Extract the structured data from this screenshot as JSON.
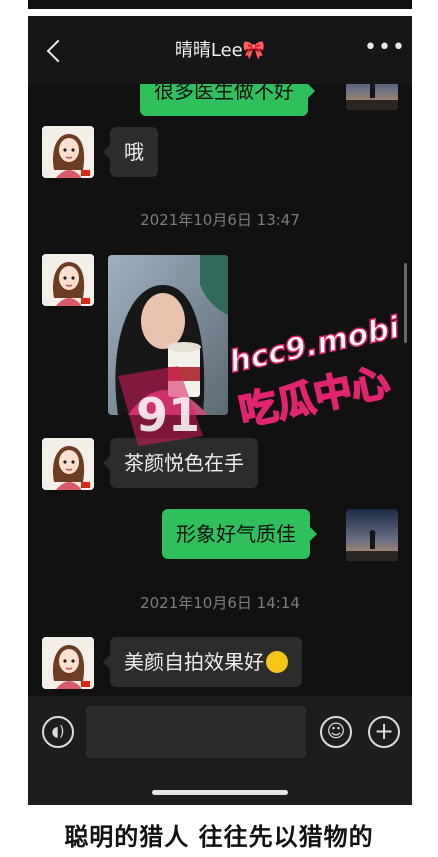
{
  "header": {
    "title": "晴晴Lee🎀",
    "more_label": "•••"
  },
  "messages": [
    {
      "side": "right",
      "text": "很多医生做不好"
    },
    {
      "side": "left",
      "text": "哦"
    },
    {
      "timestamp": "2021年10月6日 13:47"
    },
    {
      "side": "left",
      "type": "image"
    },
    {
      "side": "left",
      "text": "茶颜悦色在手"
    },
    {
      "side": "right",
      "text": "形象好气质佳"
    },
    {
      "timestamp": "2021年10月6日 14:14"
    },
    {
      "side": "left",
      "text": "美颜自拍效果好"
    }
  ],
  "watermark": {
    "line1": "hcc9.mobi",
    "line2": "吃瓜中心",
    "badge": "91"
  },
  "caption": "聪明的猎人  往往先以猎物的",
  "colors": {
    "bubble_green": "#2fbf5c",
    "bubble_dark": "#2c2c2c",
    "background": "#111111"
  }
}
